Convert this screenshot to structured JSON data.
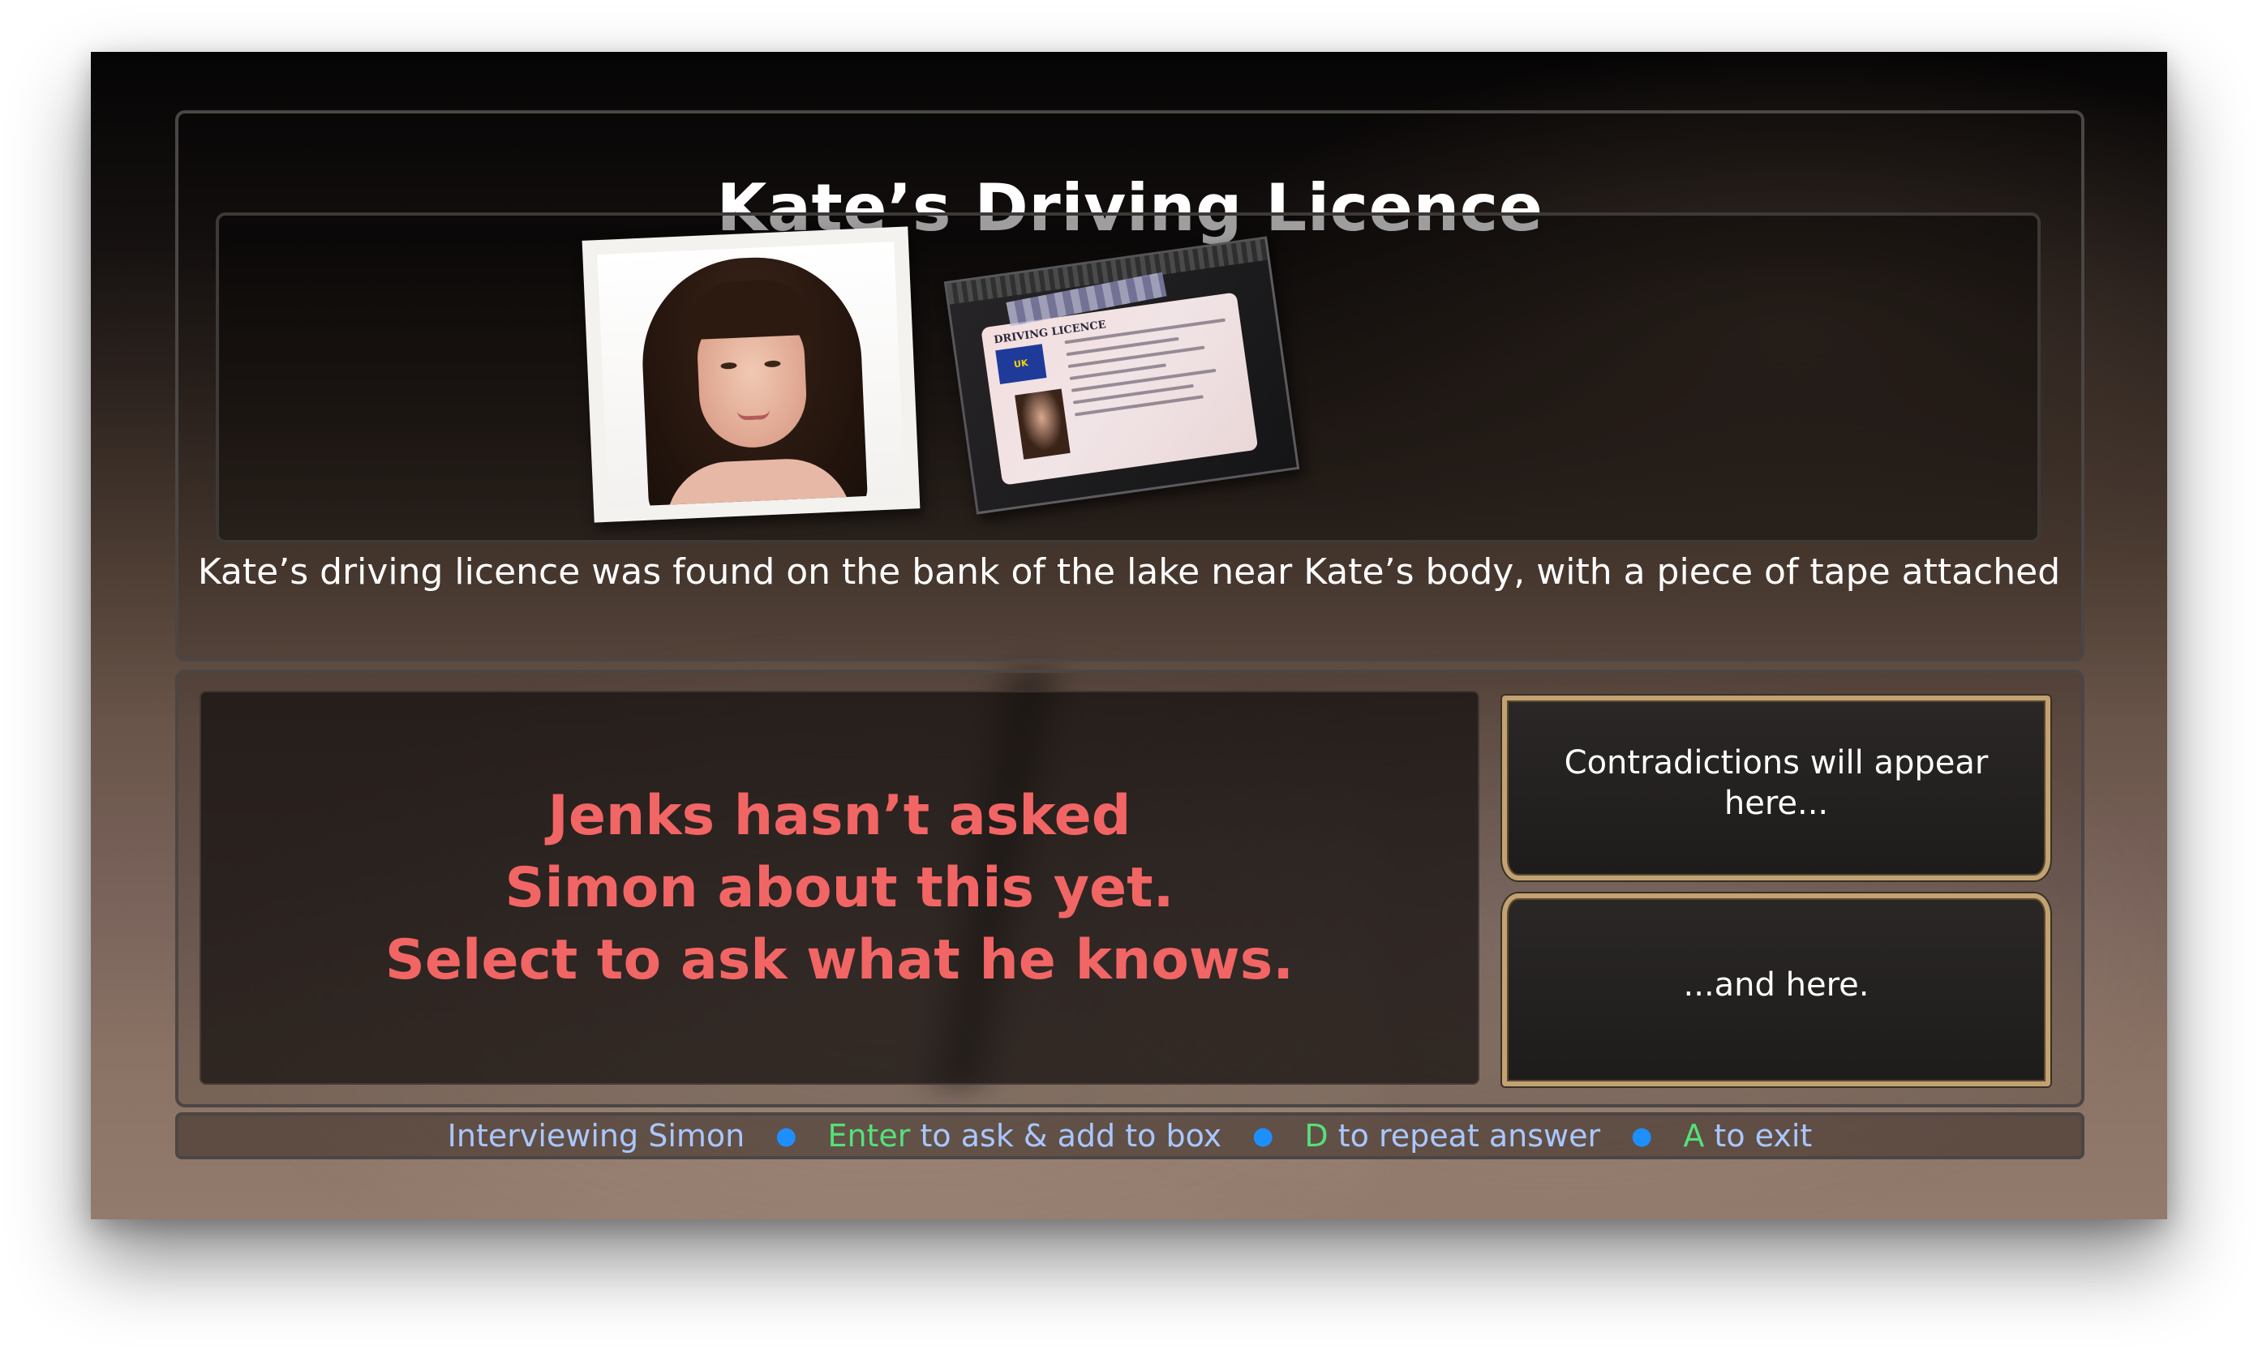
{
  "evidence": {
    "title": "Kate’s Driving Licence",
    "caption": "Kate’s driving licence was found on the bank of the lake near Kate’s body, with a piece of tape attached",
    "licence_card": {
      "heading": "DRIVING LICENCE",
      "flag_label": "UK"
    }
  },
  "answer": {
    "text": "Jenks hasn’t asked\nSimon about this yet.\nSelect to ask what he knows."
  },
  "contradictions": {
    "top_text": "Contradictions will appear here...",
    "bottom_text": "...and here."
  },
  "status_bar": {
    "interviewing": "Interviewing Simon",
    "enter_key": "Enter",
    "enter_action": "to ask & add to box",
    "d_key": "D",
    "d_action": "to repeat answer",
    "a_key": "A",
    "a_action": "to exit",
    "separator": "●"
  },
  "colors": {
    "answer_text": "#f26565",
    "key_hint": "#55e07a",
    "status_text": "#a9c7ff",
    "separator_dot": "#1e8fff",
    "gold_frame": "#c3a272"
  }
}
